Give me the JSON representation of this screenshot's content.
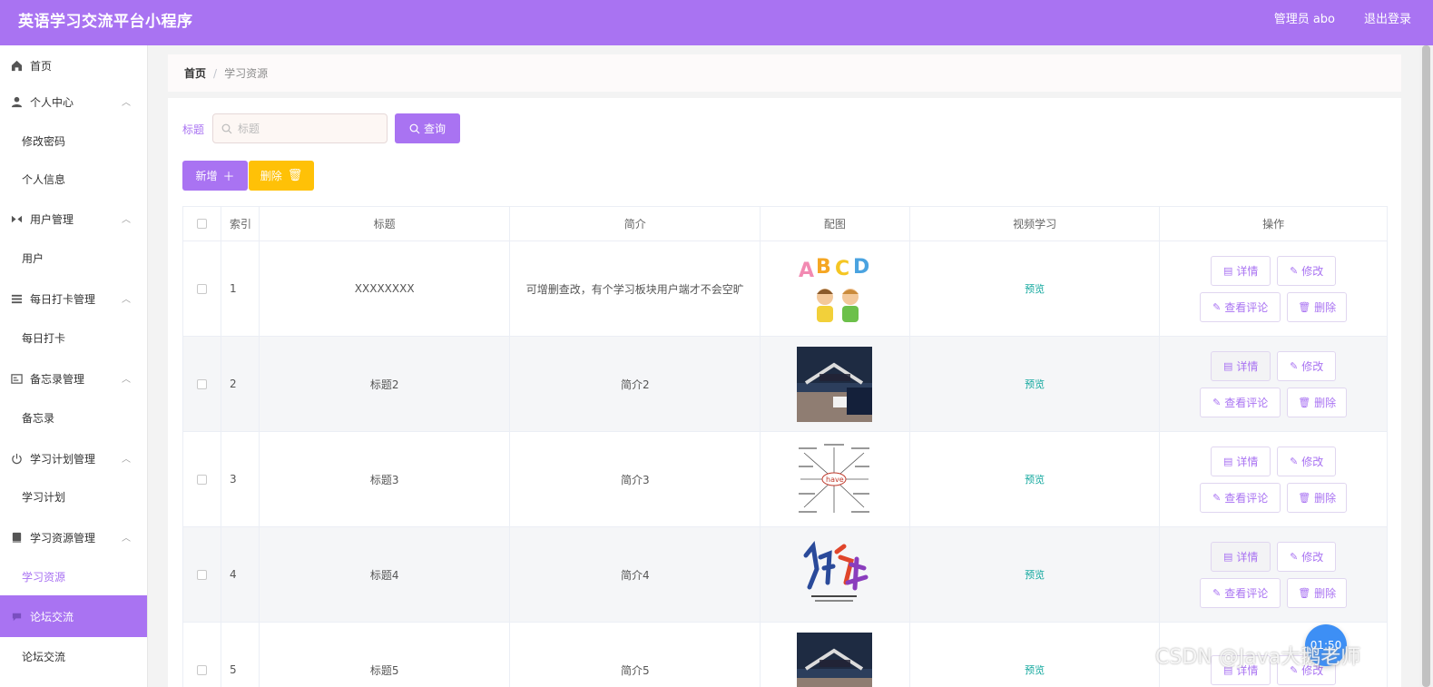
{
  "header": {
    "app_title": "英语学习交流平台小程序",
    "user": "管理员 abo",
    "logout": "退出登录"
  },
  "sidebar": {
    "home": "首页",
    "groups": [
      {
        "label": "个人中心",
        "subs": [
          "修改密码",
          "个人信息"
        ]
      },
      {
        "label": "用户管理",
        "subs": [
          "用户"
        ]
      },
      {
        "label": "每日打卡管理",
        "subs": [
          "每日打卡"
        ]
      },
      {
        "label": "备忘录管理",
        "subs": [
          "备忘录"
        ]
      },
      {
        "label": "学习计划管理",
        "subs": [
          "学习计划"
        ]
      },
      {
        "label": "学习资源管理",
        "subs": [
          "学习资源"
        ]
      }
    ],
    "active": {
      "label": "论坛交流",
      "sub": "论坛交流"
    }
  },
  "breadcrumb": {
    "home": "首页",
    "sep": "/",
    "current": "学习资源"
  },
  "search": {
    "label": "标题",
    "placeholder": "标题",
    "query_button": "查询"
  },
  "actions": {
    "add": "新增",
    "delete": "删除"
  },
  "table": {
    "columns": [
      "索引",
      "标题",
      "简介",
      "配图",
      "视频学习",
      "操作"
    ],
    "rows": [
      {
        "index": "1",
        "title": "XXXXXXXX",
        "intro": "可增删查改，有个学习板块用户端才不会空旷",
        "video": "预览"
      },
      {
        "index": "2",
        "title": "标题2",
        "intro": "简介2",
        "video": "预览"
      },
      {
        "index": "3",
        "title": "标题3",
        "intro": "简介3",
        "video": "预览"
      },
      {
        "index": "4",
        "title": "标题4",
        "intro": "简介4",
        "video": "预览"
      },
      {
        "index": "5",
        "title": "标题5",
        "intro": "简介5",
        "video": "预览"
      }
    ],
    "ops": {
      "detail": "详情",
      "edit": "修改",
      "comment": "查看评论",
      "delete": "删除"
    }
  },
  "timer": "01:50",
  "watermark": "CSDN @Java大鹅老师",
  "colors": {
    "accent": "#a973f2",
    "warning": "#ffc107",
    "link": "#13a89e"
  }
}
